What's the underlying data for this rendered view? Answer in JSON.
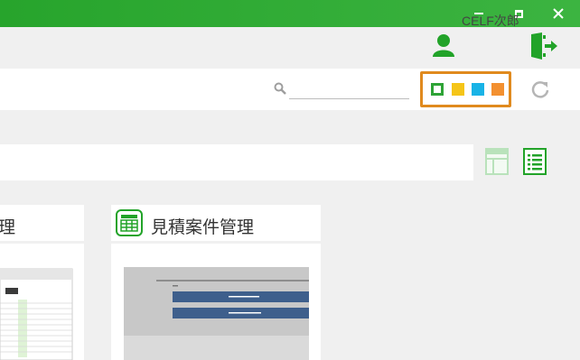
{
  "user": {
    "name": "CELF次郎"
  },
  "search": {
    "value": "",
    "placeholder": ""
  },
  "theme_colors": [
    "#2ea336",
    "#f5c518",
    "#19b3e6",
    "#f39030"
  ],
  "cards": [
    {
      "title": "理"
    },
    {
      "title": "見積案件管理"
    }
  ]
}
